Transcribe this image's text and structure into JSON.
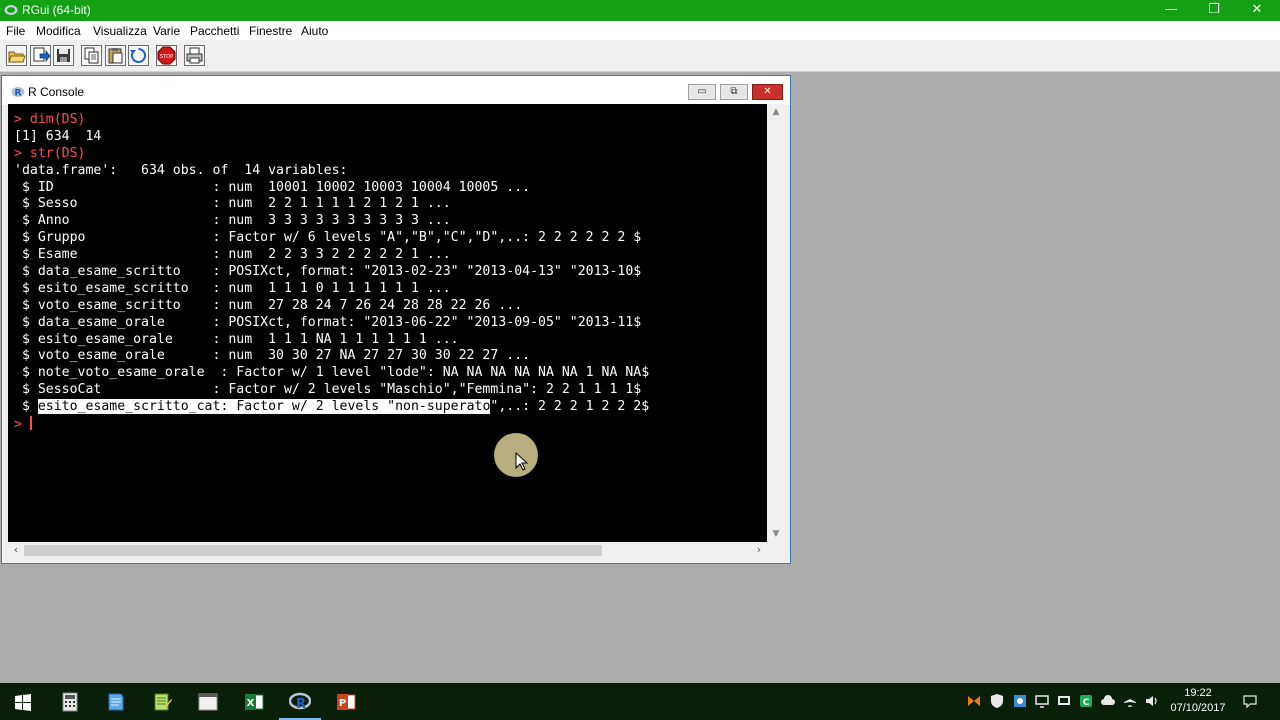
{
  "window": {
    "title": "RGui (64-bit)",
    "minimize_glyph": "—",
    "restore_glyph": "❐",
    "close_glyph": "✕"
  },
  "menu": [
    "File",
    "Modifica",
    "Visualizza",
    "Varie",
    "Pacchetti",
    "Finestre",
    "Aiuto"
  ],
  "toolbar": {
    "icons": [
      "open-script-icon",
      "load-workspace-icon",
      "save-icon",
      "copy-icon",
      "paste-icon",
      "copy-paste-icon",
      "stop-icon",
      "print-icon"
    ],
    "stop_label": "STOP"
  },
  "console_window": {
    "title": "R Console",
    "minimize_glyph": "▭",
    "restore_glyph": "⧉",
    "close_glyph": "✕"
  },
  "console": {
    "lines": [
      {
        "prompt": "> ",
        "text": "dim(DS)"
      },
      {
        "text": "[1] 634  14"
      },
      {
        "prompt": "> ",
        "text": "str(DS)"
      },
      {
        "text": "'data.frame':\t634 obs. of  14 variables:"
      },
      {
        "text": " $ ID                    : num  10001 10002 10003 10004 10005 ..."
      },
      {
        "text": " $ Sesso                 : num  2 2 1 1 1 1 2 1 2 1 ..."
      },
      {
        "text": " $ Anno                  : num  3 3 3 3 3 3 3 3 3 3 ..."
      },
      {
        "text": " $ Gruppo                : Factor w/ 6 levels \"A\",\"B\",\"C\",\"D\",..: 2 2 2 2 2 2 $"
      },
      {
        "text": " $ Esame                 : num  2 2 3 3 2 2 2 2 2 1 ..."
      },
      {
        "text": " $ data_esame_scritto    : POSIXct, format: \"2013-02-23\" \"2013-04-13\" \"2013-10$"
      },
      {
        "text": " $ esito_esame_scritto   : num  1 1 1 0 1 1 1 1 1 1 ..."
      },
      {
        "text": " $ voto_esame_scritto    : num  27 28 24 7 26 24 28 28 22 26 ..."
      },
      {
        "text": " $ data_esame_orale      : POSIXct, format: \"2013-06-22\" \"2013-09-05\" \"2013-11$"
      },
      {
        "text": " $ esito_esame_orale     : num  1 1 1 NA 1 1 1 1 1 1 ..."
      },
      {
        "text": " $ voto_esame_orale      : num  30 30 27 NA 27 27 30 30 22 27 ..."
      },
      {
        "text": " $ note_voto_esame_orale  : Factor w/ 1 level \"lode\": NA NA NA NA NA NA 1 NA NA$"
      },
      {
        "text": " $ SessoCat              : Factor w/ 2 levels \"Maschio\",\"Femmina\": 2 2 1 1 1 1$"
      },
      {
        "pre": " $ ",
        "selected": "esito_esame_scritto_cat: Factor w/ 2 levels \"non-superato",
        "post": "\",..: 2 2 2 1 2 2 2$"
      },
      {
        "prompt": "> ",
        "text": ""
      }
    ]
  },
  "clock": {
    "time": "19:22",
    "date": "07/10/2017"
  }
}
